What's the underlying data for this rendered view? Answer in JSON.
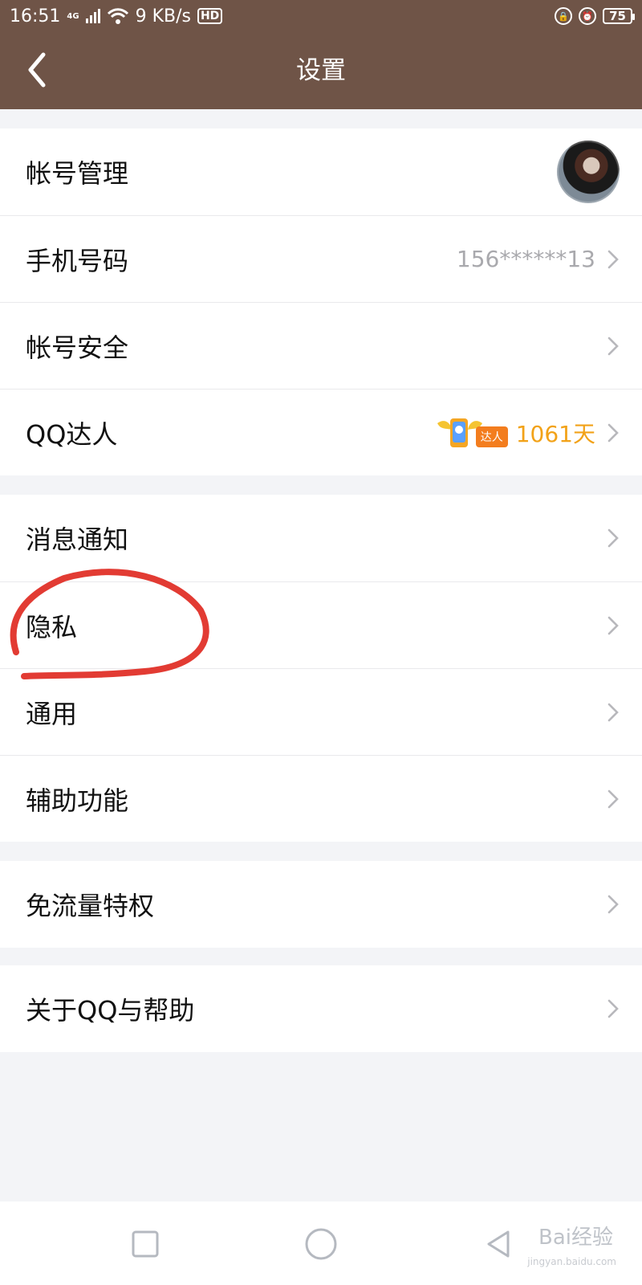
{
  "status": {
    "time": "16:51",
    "network": "4G",
    "speed": "9 KB/s",
    "hd": "HD",
    "battery": "75"
  },
  "titlebar": {
    "title": "设置"
  },
  "groups": [
    {
      "rows": [
        {
          "label": "帐号管理"
        },
        {
          "label": "手机号码",
          "value": "156******13"
        },
        {
          "label": "帐号安全"
        },
        {
          "label": "QQ达人",
          "badge_text": "达人",
          "value": "1061天"
        }
      ]
    },
    {
      "rows": [
        {
          "label": "消息通知"
        },
        {
          "label": "隐私"
        },
        {
          "label": "通用"
        },
        {
          "label": "辅助功能"
        }
      ]
    },
    {
      "rows": [
        {
          "label": "免流量特权"
        }
      ]
    },
    {
      "rows": [
        {
          "label": "关于QQ与帮助"
        }
      ]
    }
  ],
  "watermark": {
    "brand": "Bai经验",
    "url": "jingyan.baidu.com"
  },
  "colors": {
    "header": "#6f5447",
    "accent": "#f2a218",
    "annotation": "#e23b33"
  },
  "icons": {
    "back": "chevron-left-icon",
    "row_arrow": "chevron-right-icon",
    "nav_recent": "square-icon",
    "nav_home": "circle-icon",
    "nav_back": "triangle-back-icon"
  }
}
